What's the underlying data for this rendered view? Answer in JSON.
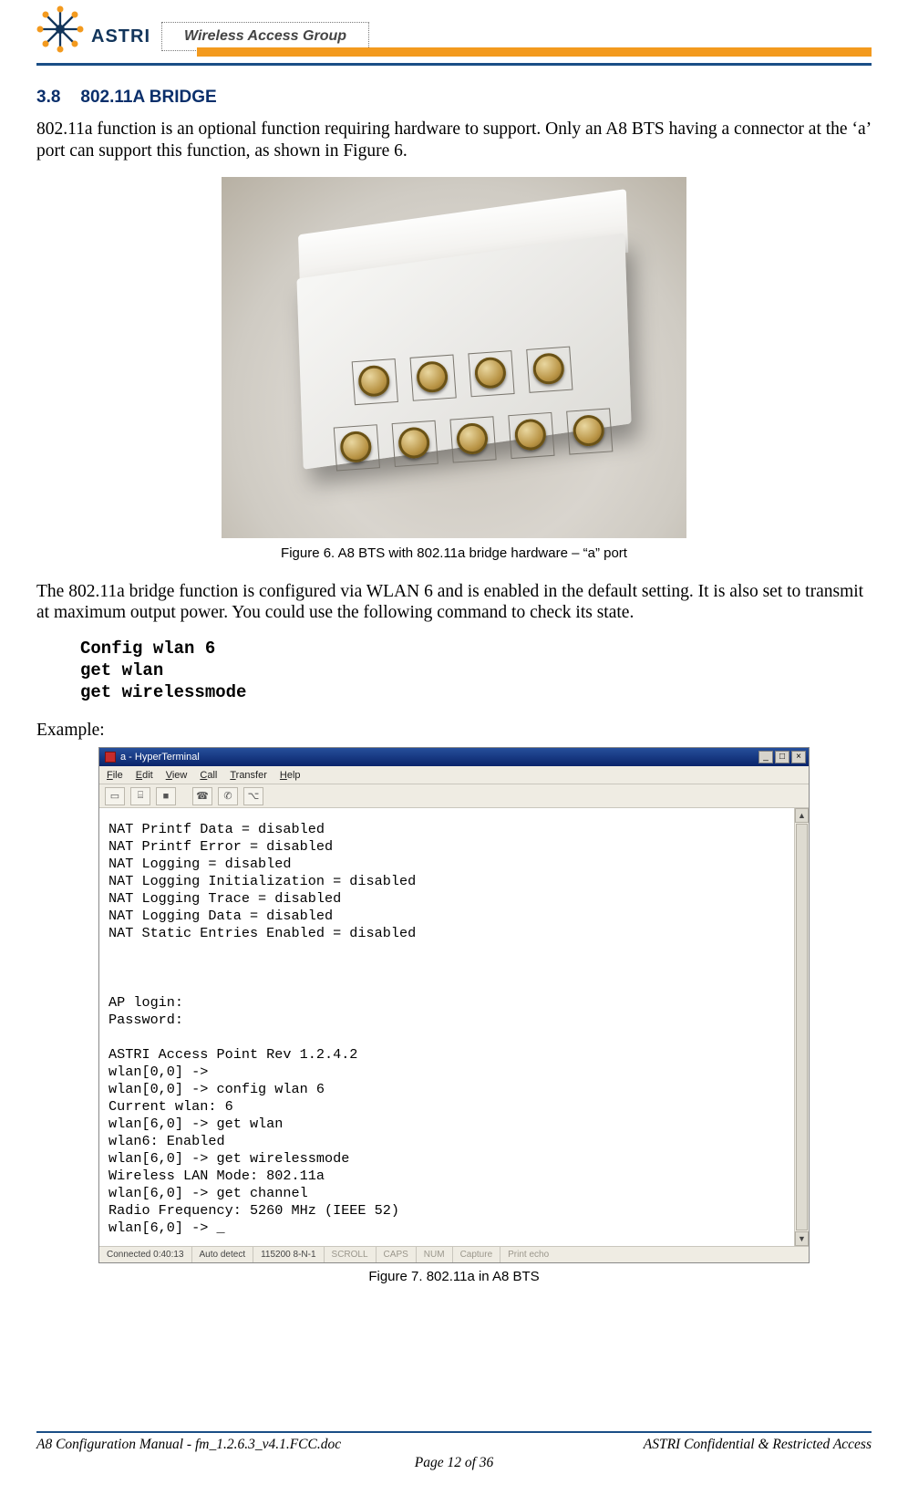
{
  "header": {
    "brand": "ASTRI",
    "badge": "Wireless Access Group"
  },
  "section": {
    "number": "3.8",
    "title": "802.11A BRIDGE"
  },
  "body": {
    "para1": "802.11a function is an optional function requiring hardware to support. Only an A8 BTS having a connector at the ‘a’ port can support this function, as shown in Figure 6.",
    "fig6_caption": "Figure 6. A8 BTS with 802.11a bridge hardware – “a” port",
    "para2": "The 802.11a bridge function is configured via WLAN 6 and is enabled in the default setting. It is also set to transmit at maximum output power. You could use the following command to check its state.",
    "commands": [
      "Config wlan 6",
      "get wlan",
      "get wirelessmode"
    ],
    "example_label": "Example:",
    "fig7_caption": "Figure 7. 802.11a in A8 BTS"
  },
  "terminal": {
    "title": "a - HyperTerminal",
    "win_buttons": {
      "min": "_",
      "max": "□",
      "close": "×"
    },
    "menus": [
      "File",
      "Edit",
      "View",
      "Call",
      "Transfer",
      "Help"
    ],
    "menu_underline_idx": [
      0,
      0,
      0,
      0,
      0,
      0
    ],
    "toolbar_icons": [
      "new-icon",
      "open-icon",
      "save-icon",
      "call-icon",
      "hangup-icon",
      "properties-icon"
    ],
    "lines": [
      "NAT Printf Data = disabled",
      "NAT Printf Error = disabled",
      "NAT Logging = disabled",
      "NAT Logging Initialization = disabled",
      "NAT Logging Trace = disabled",
      "NAT Logging Data = disabled",
      "NAT Static Entries Enabled = disabled",
      "",
      "",
      "",
      "AP login:",
      "Password:",
      "",
      "ASTRI Access Point Rev 1.2.4.2",
      "wlan[0,0] ->",
      "wlan[0,0] -> config wlan 6",
      "Current wlan: 6",
      "wlan[6,0] -> get wlan",
      "wlan6: Enabled",
      "wlan[6,0] -> get wirelessmode",
      "Wireless LAN Mode: 802.11a",
      "wlan[6,0] -> get channel",
      "Radio Frequency: 5260 MHz (IEEE 52)",
      "wlan[6,0] -> _"
    ],
    "status": {
      "connected": "Connected 0:40:13",
      "detect": "Auto detect",
      "serial": "115200 8-N-1",
      "scroll": "SCROLL",
      "caps": "CAPS",
      "num": "NUM",
      "capture": "Capture",
      "printecho": "Print echo"
    }
  },
  "footer": {
    "left": "A8 Configuration Manual - fm_1.2.6.3_v4.1.FCC.doc",
    "right": "ASTRI Confidential & Restricted Access",
    "center": "Page 12 of 36"
  }
}
